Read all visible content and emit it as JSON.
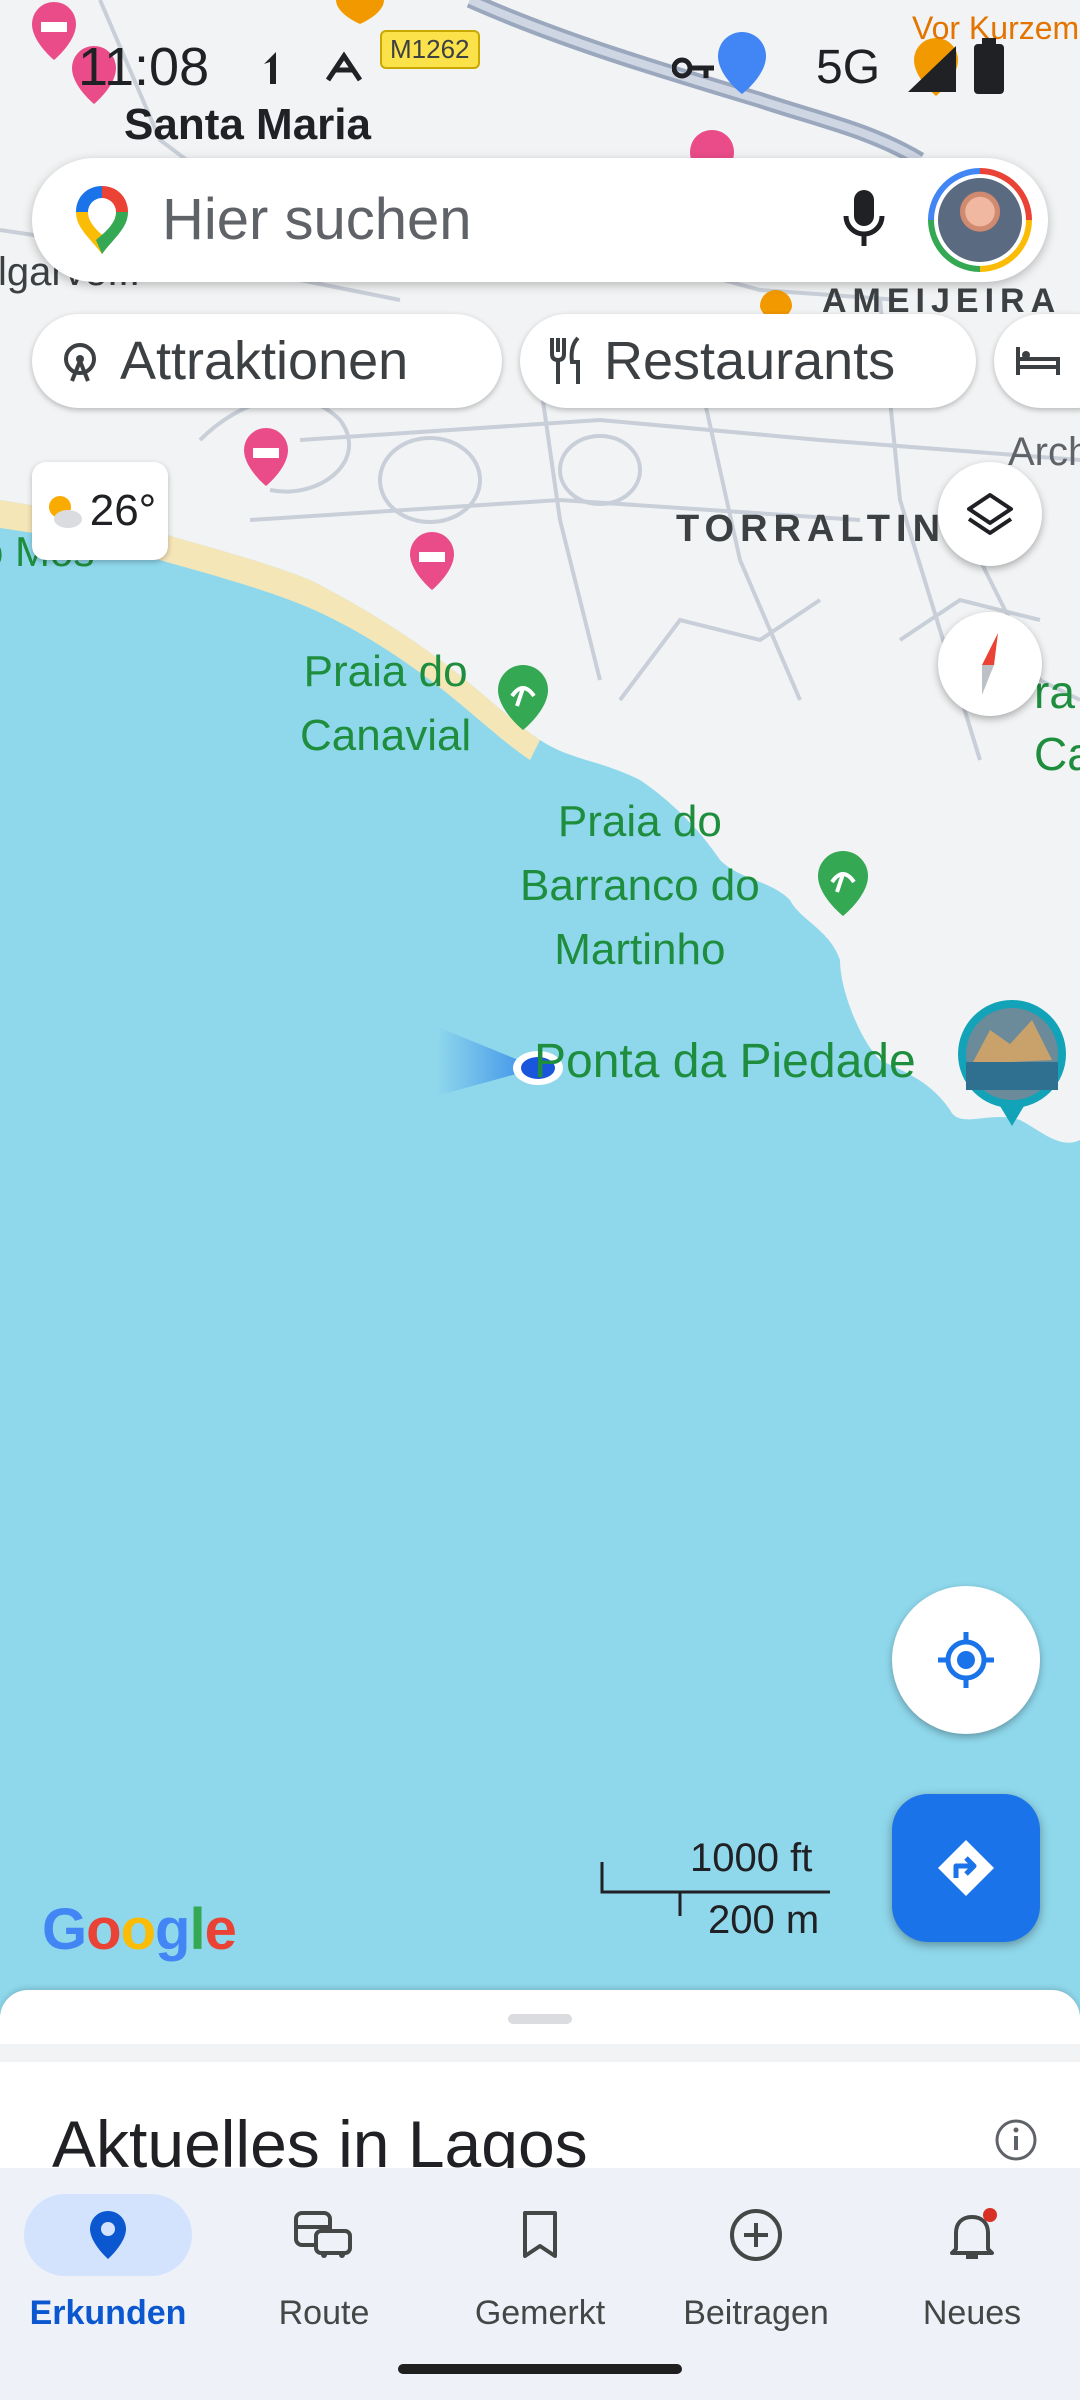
{
  "status_bar": {
    "time": "11:08",
    "network": "5G"
  },
  "search": {
    "placeholder": "Hier suchen"
  },
  "chips": [
    {
      "label": "Attraktionen",
      "icon": "ferris-wheel-icon"
    },
    {
      "label": "Restaurants",
      "icon": "fork-knife-icon"
    },
    {
      "label": "",
      "icon": "bed-icon"
    }
  ],
  "weather": {
    "temperature": "26°",
    "icon": "partly-cloudy-icon"
  },
  "map": {
    "road_badge": "M1262",
    "labels": {
      "santa_maria": "Santa Maria",
      "torraltinha": "TORRALTIN",
      "ameijeira": "AMEIJEIRA",
      "vor_kurzem": "Vor Kurzem",
      "algarve": "lgarve...",
      "mos": "o Mos",
      "praia_canavial_1": "Praia do",
      "praia_canavial_2": "Canavial",
      "barranco_1": "Praia do",
      "barranco_2": "Barranco do",
      "barranco_3": "Martinho",
      "ponta": "Ponta da Piedade",
      "arch": "Arch",
      "ra": "ra",
      "ca": "Ca"
    }
  },
  "scale": {
    "imperial": "1000 ft",
    "metric": "200 m"
  },
  "logo": "Google",
  "sheet": {
    "title": "Aktuelles in Lagos"
  },
  "nav": [
    {
      "label": "Erkunden",
      "icon": "location-pin-icon",
      "active": true
    },
    {
      "label": "Route",
      "icon": "commute-icon",
      "active": false
    },
    {
      "label": "Gemerkt",
      "icon": "bookmark-icon",
      "active": false
    },
    {
      "label": "Beitragen",
      "icon": "add-circle-icon",
      "active": false
    },
    {
      "label": "Neues",
      "icon": "bell-icon",
      "active": false
    }
  ],
  "colors": {
    "water": "#8fd8ec",
    "land": "#f1f3f4",
    "accent": "#1a73e8",
    "place_green": "#1e8e3e",
    "hotel_pink": "#ea4c89"
  }
}
